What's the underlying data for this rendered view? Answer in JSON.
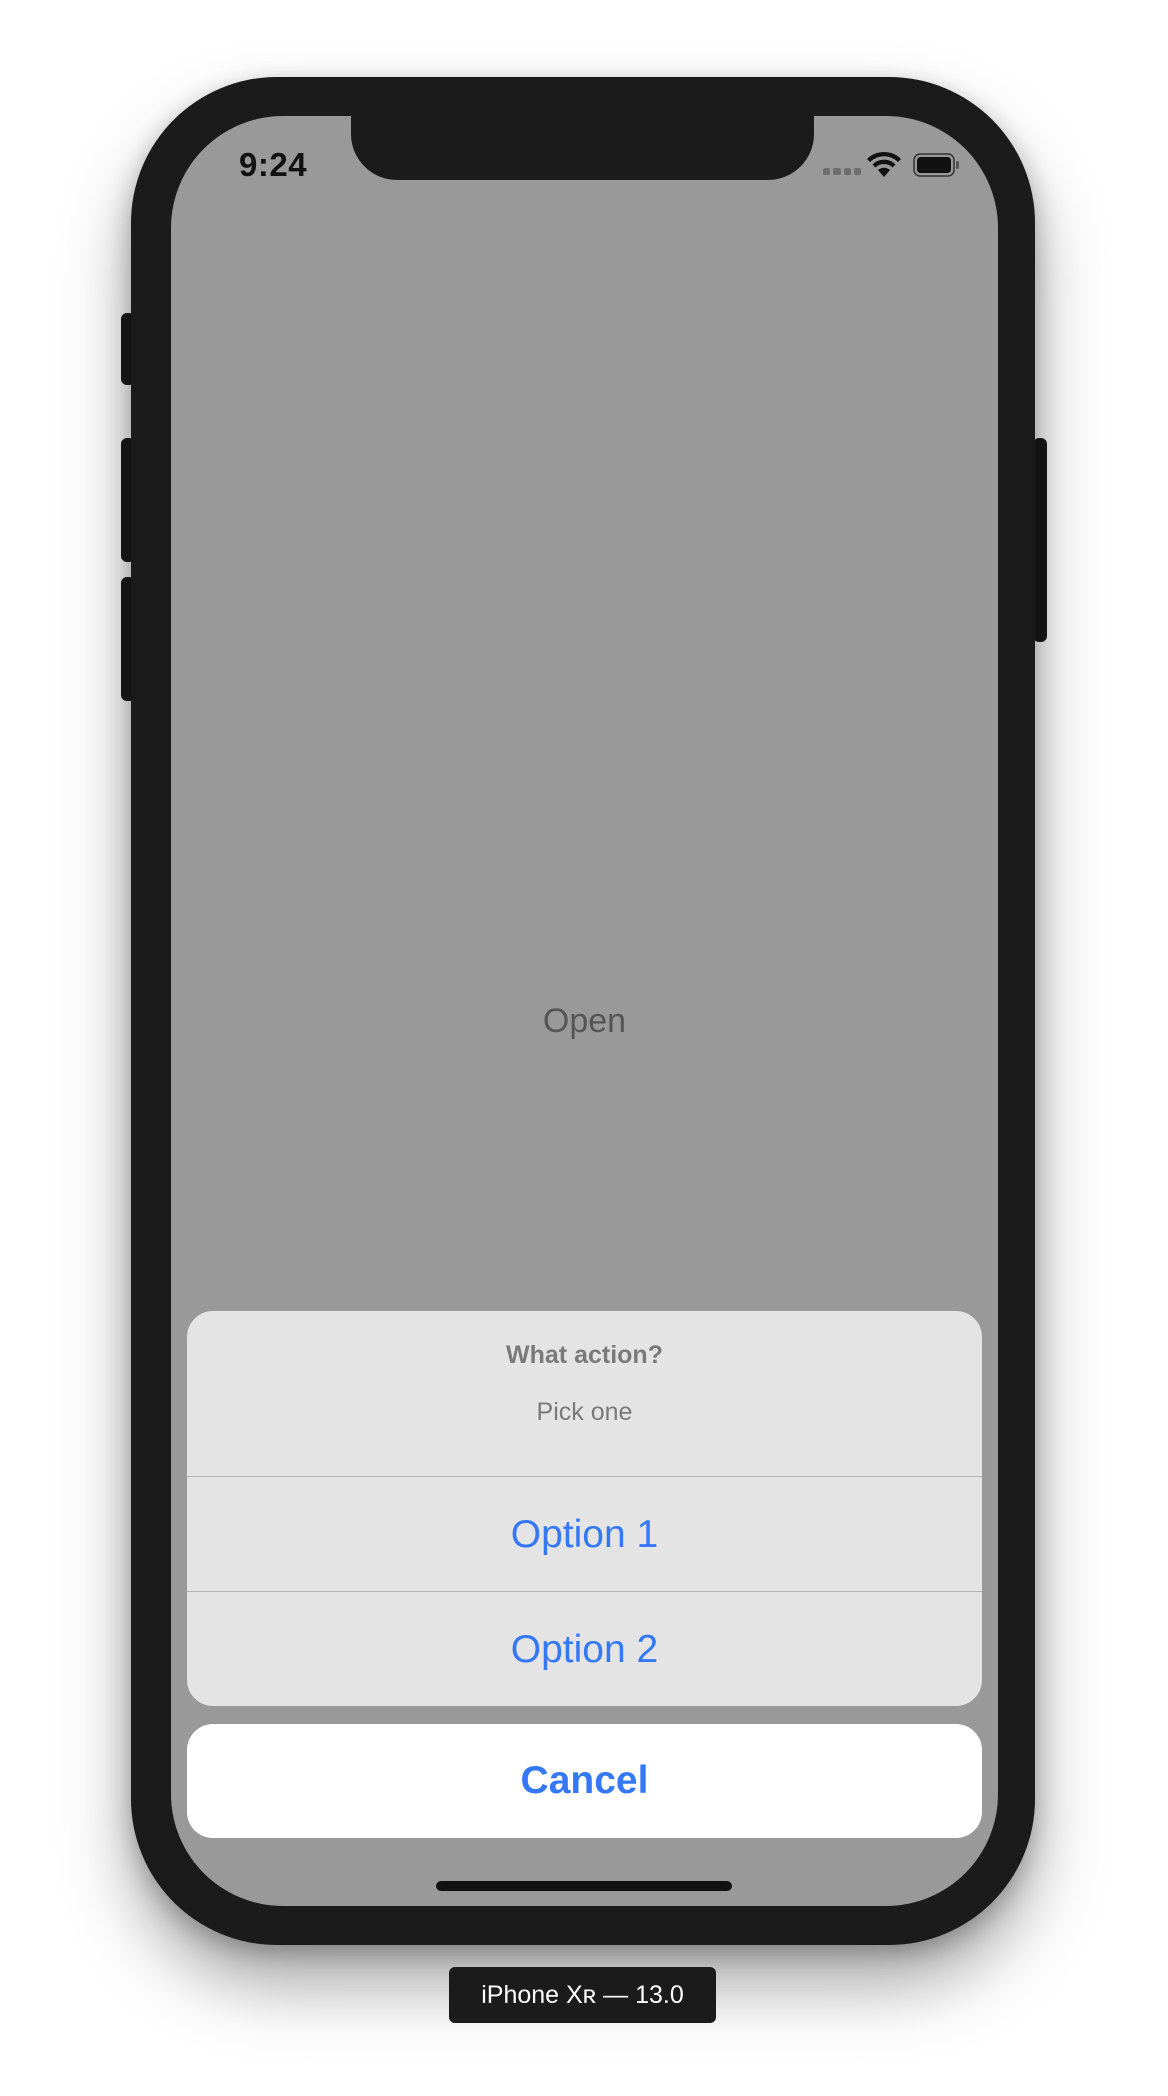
{
  "status_bar": {
    "time": "9:24",
    "icons": [
      "cellular-signal-icon",
      "wifi-icon",
      "battery-icon"
    ]
  },
  "main": {
    "open_label": "Open"
  },
  "action_sheet": {
    "title": "What action?",
    "message": "Pick one",
    "options": [
      {
        "label": "Option 1"
      },
      {
        "label": "Option 2"
      }
    ],
    "cancel_label": "Cancel"
  },
  "simulator": {
    "device_label": "iPhone Xʀ — 13.0"
  },
  "colors": {
    "accent": "#3478f6",
    "dim_background": "#999999",
    "sheet_background": "#e4e4e4",
    "device_frame": "#1b1b1b"
  }
}
